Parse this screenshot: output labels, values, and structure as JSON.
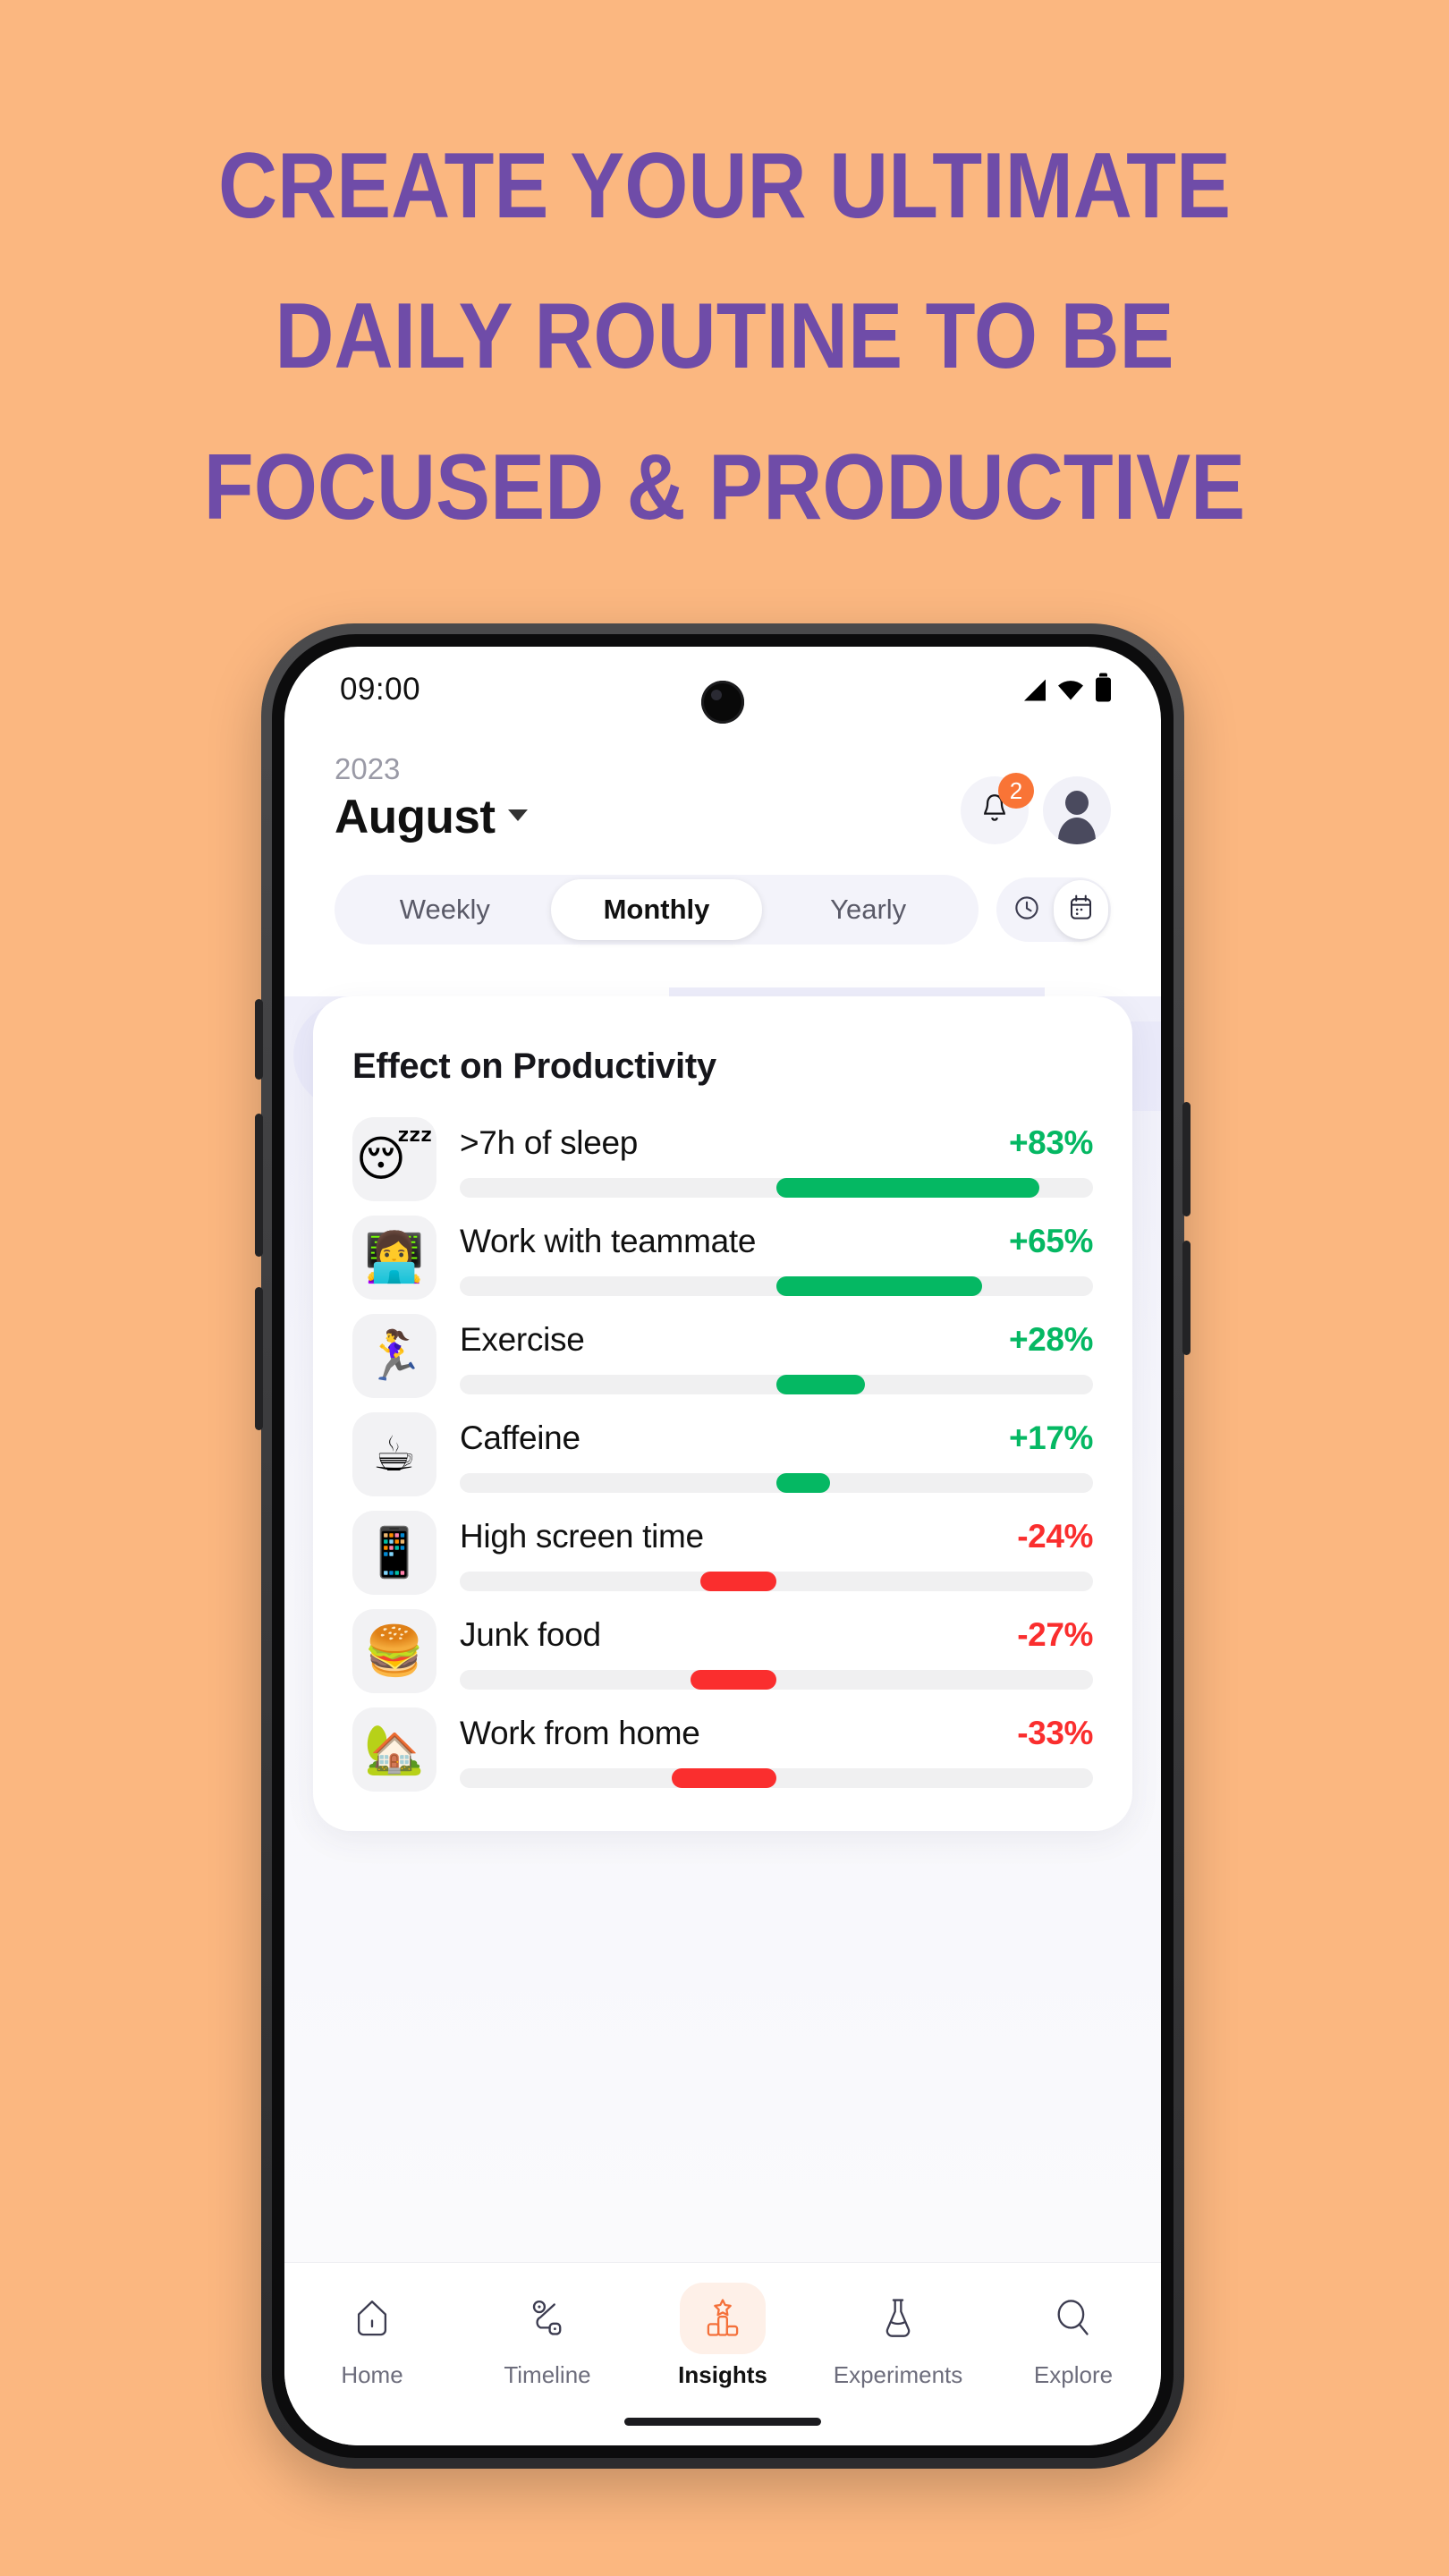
{
  "promo": {
    "background_color": "#FBB780",
    "headline_color": "#6F4CA8",
    "headline_lines": [
      "CREATE YOUR ULTIMATE",
      "DAILY ROUTINE TO BE",
      "FOCUSED & PRODUCTIVE"
    ]
  },
  "statusbar": {
    "time": "09:00",
    "icons": [
      "signal-icon",
      "wifi-icon",
      "battery-icon"
    ]
  },
  "header": {
    "year": "2023",
    "month": "August",
    "dropdown_icon": "chevron-down-icon",
    "notification_icon": "bell-icon",
    "notification_badge": "2",
    "avatar_icon": "avatar-icon"
  },
  "tabs": {
    "items": [
      {
        "label": "Weekly",
        "active": false
      },
      {
        "label": "Monthly",
        "active": true
      },
      {
        "label": "Yearly",
        "active": false
      }
    ],
    "view_toggle": [
      {
        "icon": "clock-icon",
        "active": false
      },
      {
        "icon": "calendar-icon",
        "active": true
      }
    ]
  },
  "card": {
    "title": "Effect on Productivity"
  },
  "chart_data": {
    "type": "bar",
    "title": "Effect on Productivity",
    "xlabel": "",
    "ylabel": "",
    "orientation": "horizontal-diverging",
    "baseline": 0,
    "xlim": [
      -100,
      100
    ],
    "grid": false,
    "legend": "none",
    "categories": [
      ">7h of sleep",
      "Work with teammate",
      "Exercise",
      "Caffeine",
      "High screen time",
      "Junk food",
      "Work from home"
    ],
    "values": [
      83,
      65,
      28,
      17,
      -24,
      -27,
      -33
    ],
    "labels": [
      "+83%",
      "+65%",
      "+28%",
      "+17%",
      "-24%",
      "-27%",
      "-33%"
    ],
    "icons": [
      "😴",
      "👩‍💻",
      "🏃‍♀️",
      "☕",
      "📱",
      "🍔",
      "🏡"
    ],
    "positive_color": "#05B863",
    "negative_color": "#FA2E2E",
    "track_color": "#F0F0F1"
  },
  "bottomnav": {
    "items": [
      {
        "label": "Home",
        "icon": "home-icon",
        "active": false
      },
      {
        "label": "Timeline",
        "icon": "timeline-icon",
        "active": false
      },
      {
        "label": "Insights",
        "icon": "insights-icon",
        "active": true
      },
      {
        "label": "Experiments",
        "icon": "experiments-icon",
        "active": false
      },
      {
        "label": "Explore",
        "icon": "explore-icon",
        "active": false
      }
    ],
    "active_color": "#F4703A"
  }
}
